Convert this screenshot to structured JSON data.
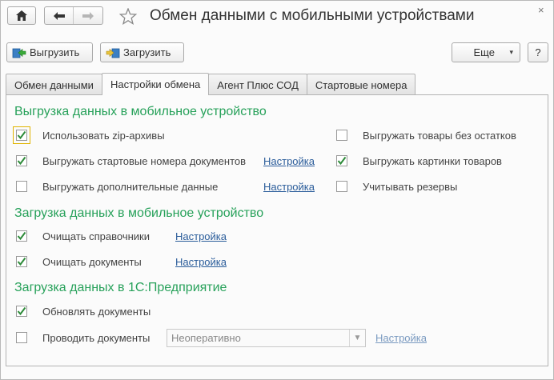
{
  "window": {
    "title": "Обмен данными с мобильными устройствами",
    "close_glyph": "×"
  },
  "toolbar": {
    "export_label": "Выгрузить",
    "import_label": "Загрузить",
    "more_label": "Еще",
    "help_label": "?"
  },
  "tabs": [
    {
      "label": "Обмен данными",
      "active": false
    },
    {
      "label": "Настройки обмена",
      "active": true
    },
    {
      "label": "Агент Плюс СОД",
      "active": false
    },
    {
      "label": "Стартовые номера",
      "active": false
    }
  ],
  "export_section": {
    "title": "Выгрузка данных в мобильное устройство",
    "use_zip": {
      "label": "Использовать zip-архивы",
      "checked": true
    },
    "start_numbers": {
      "label": "Выгружать стартовые номера документов",
      "checked": true,
      "link": "Настройка"
    },
    "extra_data": {
      "label": "Выгружать дополнительные данные",
      "checked": false,
      "link": "Настройка"
    },
    "no_stock": {
      "label": "Выгружать товары без остатков",
      "checked": false
    },
    "images": {
      "label": "Выгружать картинки товаров",
      "checked": true
    },
    "reserves": {
      "label": "Учитывать резервы",
      "checked": false
    }
  },
  "load_mobile_section": {
    "title": "Загрузка данных в мобильное устройство",
    "clear_refs": {
      "label": "Очищать справочники",
      "checked": true,
      "link": "Настройка"
    },
    "clear_docs": {
      "label": "Очищать документы",
      "checked": true,
      "link": "Настройка"
    }
  },
  "load_1c_section": {
    "title": "Загрузка данных в 1С:Предприятие",
    "update_docs": {
      "label": "Обновлять документы",
      "checked": true
    },
    "post_docs": {
      "label": "Проводить документы",
      "checked": false,
      "select_value": "Неоперативно",
      "link": "Настройка"
    }
  },
  "colors": {
    "section_green": "#27a15a",
    "link_blue": "#2a5c9a",
    "check_green": "#2e8b3a"
  }
}
